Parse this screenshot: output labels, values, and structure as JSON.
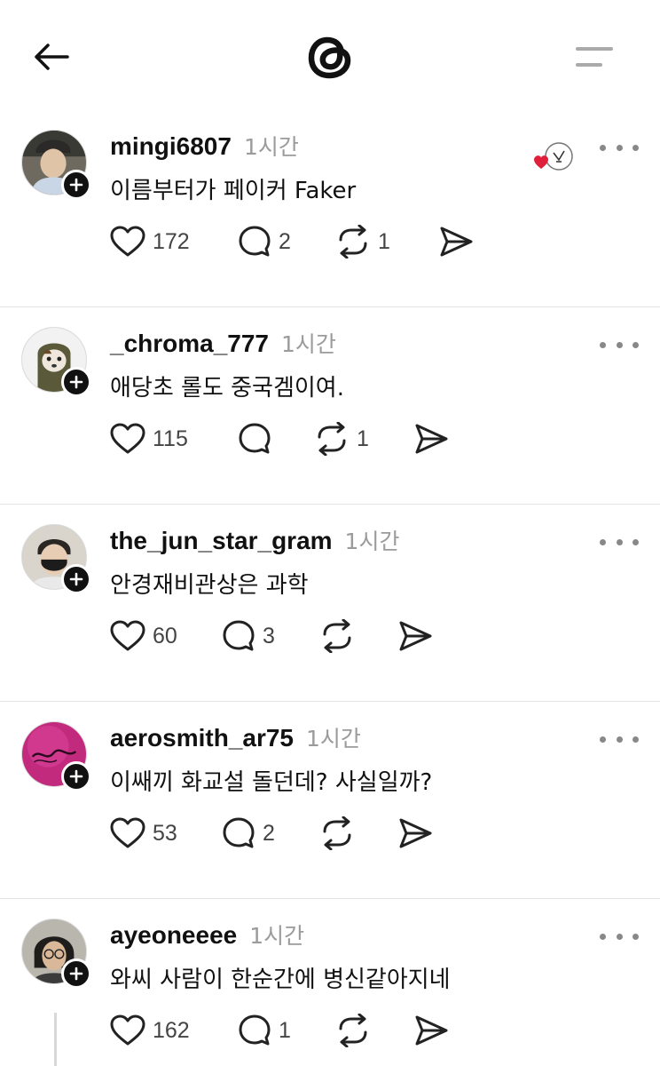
{
  "header": {
    "back_icon": "arrow-left-icon",
    "logo_icon": "threads-logo-icon",
    "menu_icon": "menu-icon"
  },
  "posts": [
    {
      "username": "mingi6807",
      "time": "1시간",
      "text": "이름부터가 페이커 Faker",
      "likes": "172",
      "replies": "2",
      "reposts": "1",
      "reaction_icon": "heart-badge-icon"
    },
    {
      "username": "_chroma_777",
      "time": "1시간",
      "text": "애당초 롤도 중국겜이여.",
      "likes": "115",
      "replies": "",
      "reposts": "1"
    },
    {
      "username": "the_jun_star_gram",
      "time": "1시간",
      "text": "안경재비관상은 과학",
      "likes": "60",
      "replies": "3",
      "reposts": ""
    },
    {
      "username": "aerosmith_ar75",
      "time": "1시간",
      "text": "이쌔끼 화교설 돌던데? 사실일까?",
      "likes": "53",
      "replies": "2",
      "reposts": ""
    },
    {
      "username": "ayeoneeee",
      "time": "1시간",
      "text": "와씨 사람이 한순간에 병신같아지네",
      "likes": "162",
      "replies": "1",
      "reposts": ""
    }
  ],
  "colors": {
    "text": "#111111",
    "muted": "#9b9b9b",
    "divider": "#e4e4e4",
    "reaction_heart": "#e0203a"
  }
}
